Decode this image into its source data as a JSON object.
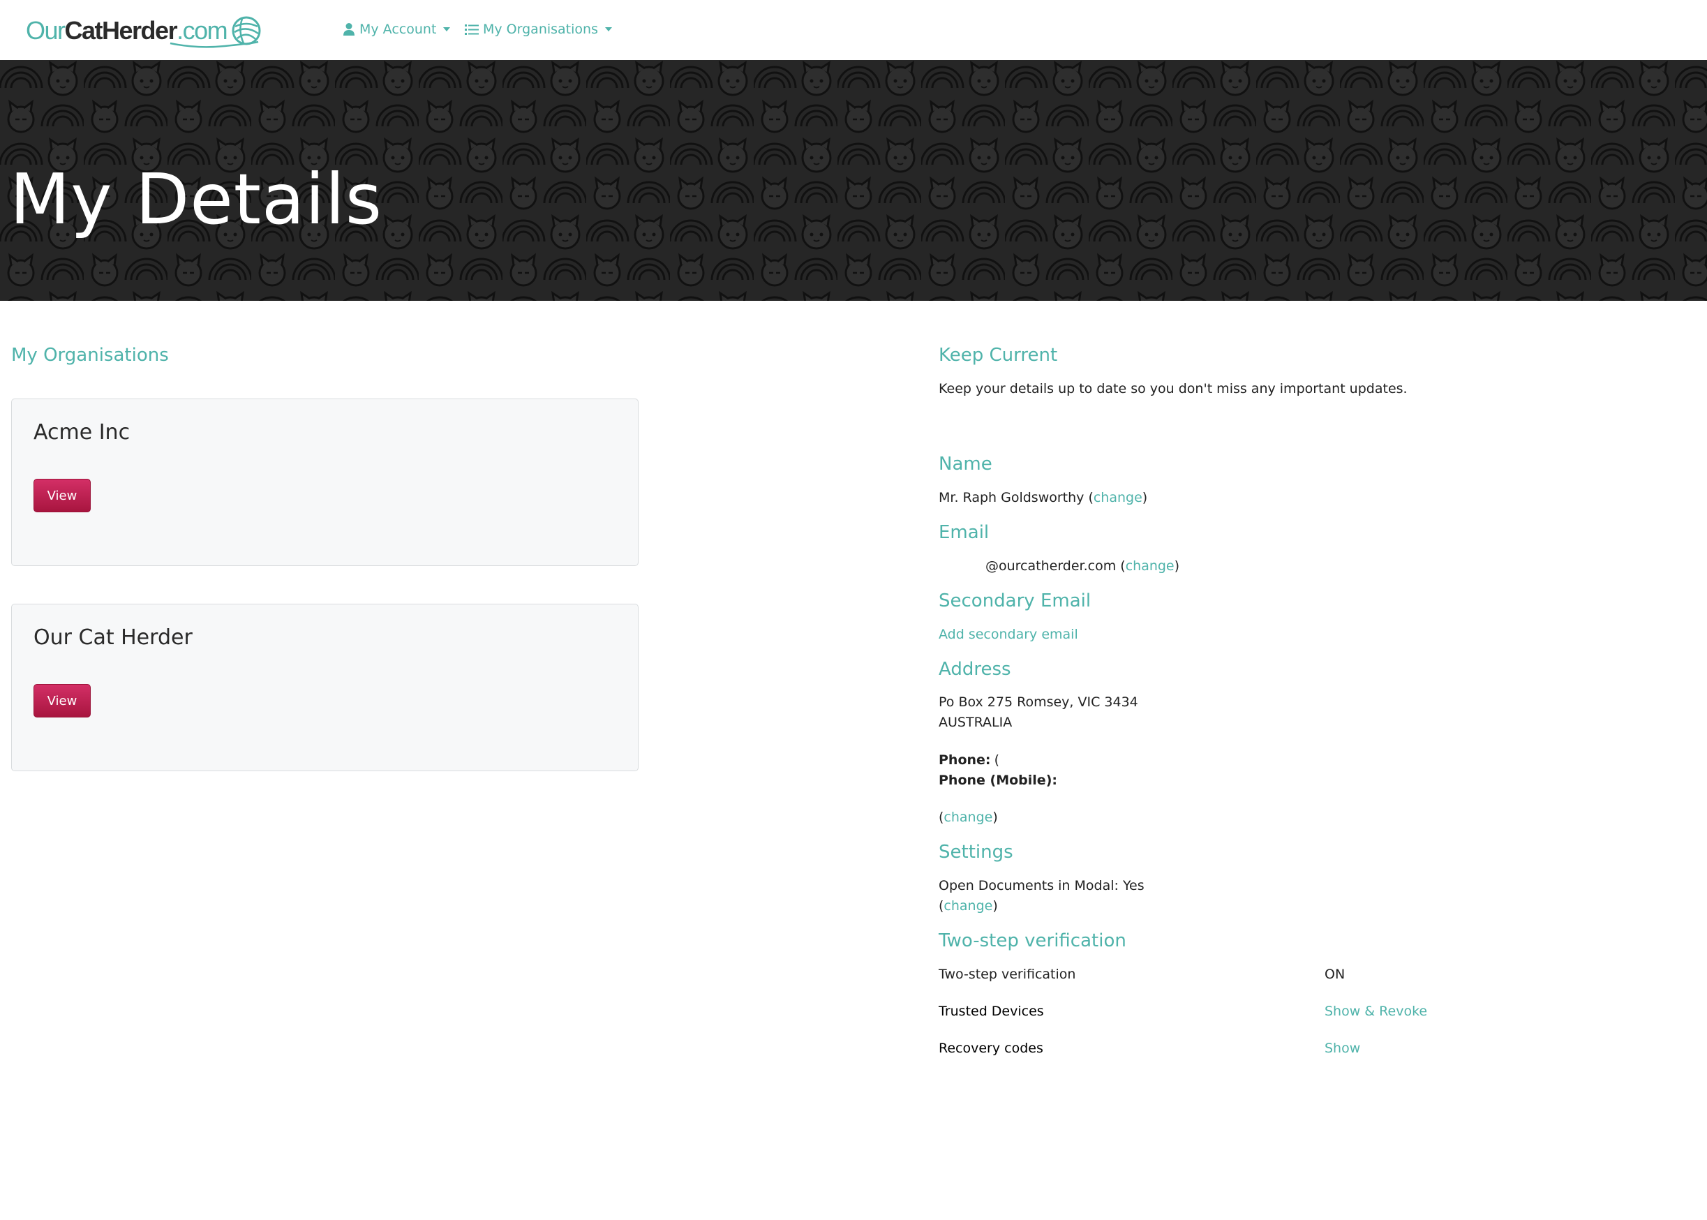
{
  "logo": {
    "our": "Our",
    "cat_herder": "CatHerder",
    "dot_com": ".com"
  },
  "nav": {
    "account_label": "My Account",
    "organisations_label": "My Organisations"
  },
  "hero": {
    "title": "My Details"
  },
  "left": {
    "heading": "My Organisations",
    "organisations": [
      {
        "name": "Acme Inc",
        "button": "View"
      },
      {
        "name": "Our Cat Herder",
        "button": "View"
      }
    ]
  },
  "right": {
    "keep_current": {
      "heading": "Keep Current",
      "text": "Keep your details up to date so you don't miss any important updates."
    },
    "name": {
      "heading": "Name",
      "value": "Mr. Raph Goldsworthy",
      "change": "change"
    },
    "email": {
      "heading": "Email",
      "value": "@ourcatherder.com",
      "change": "change"
    },
    "secondary_email": {
      "heading": "Secondary Email",
      "add_link": "Add secondary email"
    },
    "address": {
      "heading": "Address",
      "line1": "Po Box 275 Romsey, VIC 3434",
      "line2": "AUSTRALIA",
      "phone_label": "Phone:",
      "phone_value": "(",
      "mobile_label": "Phone (Mobile):",
      "change": "change"
    },
    "settings": {
      "heading": "Settings",
      "open_docs": "Open Documents in Modal: Yes",
      "change": "change"
    },
    "two_step": {
      "heading": "Two-step verification",
      "rows": [
        {
          "label": "Two-step verification",
          "value": "ON"
        },
        {
          "label": "Trusted Devices",
          "value": "Show & Revoke"
        },
        {
          "label": "Recovery codes",
          "value": "Show"
        }
      ]
    }
  },
  "colors": {
    "accent": "#4fb3aa",
    "button": "#c0204f",
    "hero_bg": "#262626"
  }
}
